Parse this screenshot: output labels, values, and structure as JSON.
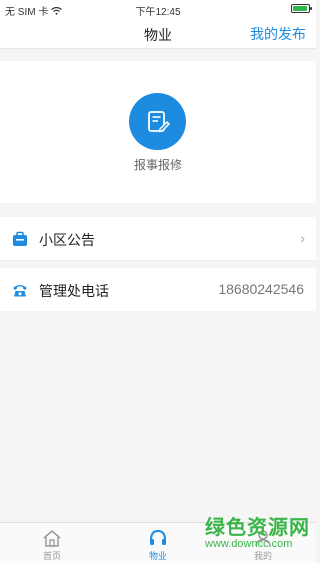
{
  "status_bar": {
    "carrier": "无 SIM 卡",
    "time": "下午12:45",
    "battery_level": 0.9
  },
  "nav": {
    "title": "物业",
    "right_action": "我的发布"
  },
  "hero": {
    "icon": "edit-document-icon",
    "label": "报事报修"
  },
  "list": [
    {
      "label": "小区公告",
      "icon": "briefcase-icon",
      "chevron": "›"
    },
    {
      "label": "管理处电话",
      "icon": "telephone-icon",
      "value": "18680242546"
    }
  ],
  "tabbar": [
    {
      "label": "首页",
      "icon": "home-icon",
      "active": false
    },
    {
      "label": "物业",
      "icon": "headset-icon",
      "active": true
    },
    {
      "label": "我的",
      "icon": "person-icon",
      "active": false
    }
  ],
  "watermark": {
    "text": "绿色资源网",
    "url": "www.downcc.com"
  },
  "colors": {
    "accent": "#1d8ce0",
    "background": "#f5f5f5"
  }
}
